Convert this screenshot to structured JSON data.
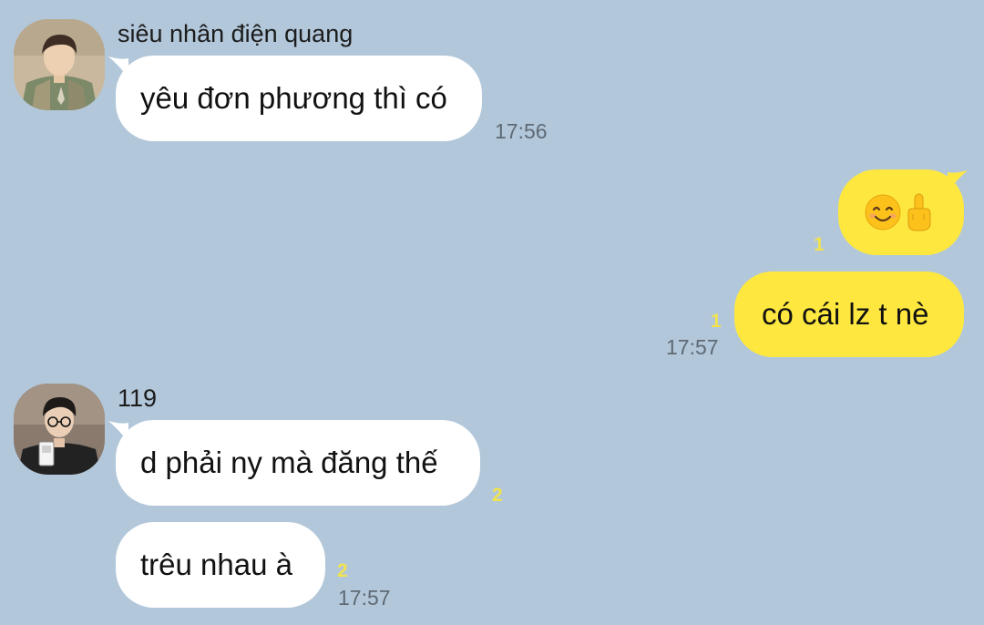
{
  "chat": {
    "messages": [
      {
        "sender": "siêu nhân điện quang",
        "text": "yêu đơn phương thì có",
        "time": "17:56"
      },
      {
        "emoji": [
          "smiling-face-emoji",
          "middle-finger-emoji"
        ],
        "unread": "1"
      },
      {
        "text": "có cái lz t nè",
        "unread": "1",
        "time": "17:57"
      },
      {
        "sender": "119",
        "text": "d phải ny mà đăng thế",
        "unread": "2"
      },
      {
        "text": "trêu nhau à",
        "unread": "2",
        "time": "17:57"
      }
    ]
  },
  "colors": {
    "background": "#b2c7da",
    "incoming_bubble": "#ffffff",
    "outgoing_bubble": "#fee83f",
    "unread_count": "#f1e34d",
    "timestamp": "#5f6a74"
  }
}
